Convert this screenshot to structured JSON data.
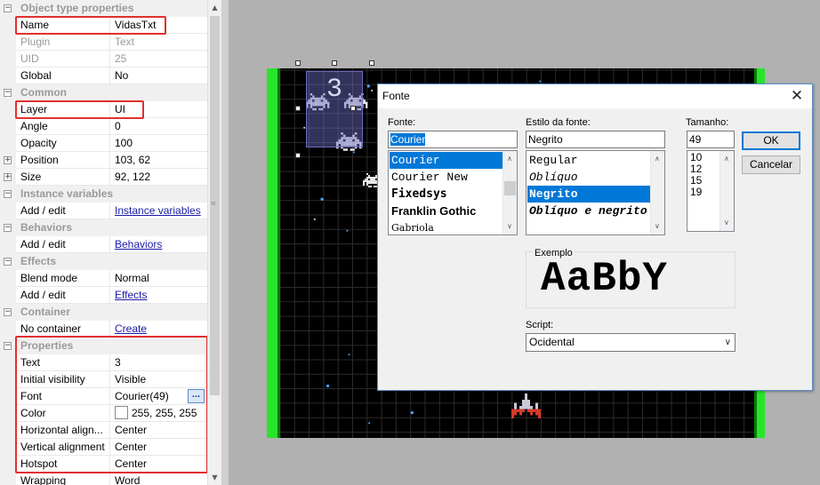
{
  "properties": {
    "rows": [
      {
        "type": "cat",
        "name": "Object type properties",
        "expander": "⊟"
      },
      {
        "type": "prop",
        "name": "Name",
        "value": "VidasTxt"
      },
      {
        "type": "prop",
        "name": "Plugin",
        "value": "Text",
        "dim": true
      },
      {
        "type": "prop",
        "name": "UID",
        "value": "25",
        "dim": true
      },
      {
        "type": "prop",
        "name": "Global",
        "value": "No"
      },
      {
        "type": "cat",
        "name": "Common",
        "expander": "⊟"
      },
      {
        "type": "prop",
        "name": "Layer",
        "value": "UI"
      },
      {
        "type": "prop",
        "name": "Angle",
        "value": "0"
      },
      {
        "type": "prop",
        "name": "Opacity",
        "value": "100"
      },
      {
        "type": "prop",
        "name": "Position",
        "value": "103, 62",
        "expander": "⊞"
      },
      {
        "type": "prop",
        "name": "Size",
        "value": "92, 122",
        "expander": "⊞"
      },
      {
        "type": "cat",
        "name": "Instance variables",
        "expander": "⊟"
      },
      {
        "type": "prop",
        "name": "Add / edit",
        "value": "Instance variables",
        "link": true
      },
      {
        "type": "cat",
        "name": "Behaviors",
        "expander": "⊟"
      },
      {
        "type": "prop",
        "name": "Add / edit",
        "value": "Behaviors",
        "link": true
      },
      {
        "type": "cat",
        "name": "Effects",
        "expander": "⊟"
      },
      {
        "type": "prop",
        "name": "Blend mode",
        "value": "Normal"
      },
      {
        "type": "prop",
        "name": "Add / edit",
        "value": "Effects",
        "link": true
      },
      {
        "type": "cat",
        "name": "Container",
        "expander": "⊟"
      },
      {
        "type": "prop",
        "name": "No container",
        "value": "Create",
        "link": true
      },
      {
        "type": "cat",
        "name": "Properties",
        "expander": "⊟"
      },
      {
        "type": "prop",
        "name": "Text",
        "value": "3"
      },
      {
        "type": "prop",
        "name": "Initial visibility",
        "value": "Visible"
      },
      {
        "type": "prop",
        "name": "Font",
        "value": "Courier(49)",
        "button": "..."
      },
      {
        "type": "prop",
        "name": "Color",
        "value": "255, 255, 255",
        "swatch": "#ffffff"
      },
      {
        "type": "prop",
        "name": "Horizontal align...",
        "value": "Center"
      },
      {
        "type": "prop",
        "name": "Vertical alignment",
        "value": "Center"
      },
      {
        "type": "prop",
        "name": "Hotspot",
        "value": "Center"
      },
      {
        "type": "prop",
        "name": "Wrapping",
        "value": "Word"
      }
    ]
  },
  "scene": {
    "selected_text": "3",
    "colors": {
      "wall": "#27e52a",
      "background": "#000000",
      "selection": "#6c6cc4"
    }
  },
  "dialog": {
    "title": "Fonte",
    "close_glyph": "✕",
    "font_label": "Fonte:",
    "font_value": "Courier",
    "font_list": [
      {
        "label": "Courier",
        "family": "\"Liberation Mono\", monospace",
        "selected": true
      },
      {
        "label": "Courier New",
        "family": "\"Liberation Mono\", monospace",
        "selected": false
      },
      {
        "label": "Fixedsys",
        "family": "\"DejaVu Sans Mono\", monospace",
        "selected": false,
        "bold": true
      },
      {
        "label": "Franklin Gothic",
        "family": "\"Liberation Sans\", sans-serif",
        "selected": false,
        "bold": true
      },
      {
        "label": "Gabriola",
        "family": "\"DejaVu Serif\", serif",
        "selected": false,
        "small": true
      }
    ],
    "style_label": "Estilo da fonte:",
    "style_value": "Negrito",
    "style_list": [
      {
        "label": "Regular",
        "selected": false
      },
      {
        "label": "Oblíquo",
        "selected": false,
        "italic": true
      },
      {
        "label": "Negrito",
        "selected": true,
        "bold": true
      },
      {
        "label": "Oblíquo e negrito",
        "selected": false,
        "italic": true,
        "bold": true
      }
    ],
    "size_label": "Tamanho:",
    "size_value": "49",
    "size_list": [
      "10",
      "12",
      "15",
      "19"
    ],
    "ok_label": "OK",
    "cancel_label": "Cancelar",
    "sample_label": "Exemplo",
    "sample_text": "AaBbY",
    "script_label": "Script:",
    "script_value": "Ocidental"
  }
}
